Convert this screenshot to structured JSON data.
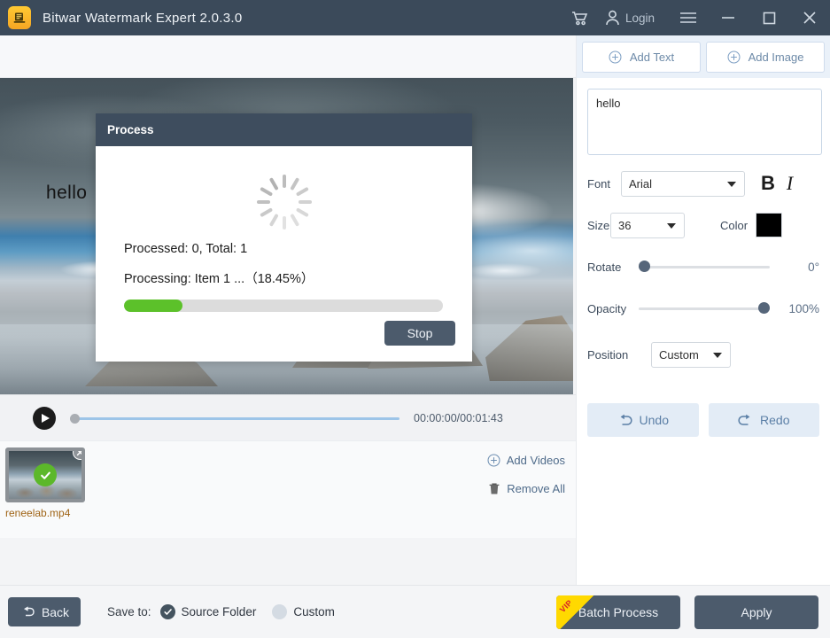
{
  "window": {
    "title": "Bitwar Watermark Expert  2.0.3.0",
    "app_icon": "app-logo-icon",
    "cart_icon": "cart-icon",
    "user_icon": "user-icon",
    "login_label": "Login",
    "menu_icon": "hamburger-menu-icon",
    "minimize_icon": "minimize-icon",
    "maximize_icon": "maximize-icon",
    "close_icon": "close-icon",
    "titlebar_color": "#3b4a5a"
  },
  "preview": {
    "watermark_text": "hello",
    "play_icon": "play-icon",
    "seek_position_percent": 0,
    "time_label": "00:00:00/00:01:43",
    "seek_color": "#9dc5e8"
  },
  "file_list": {
    "items": [
      {
        "name": "reneelab.mp4",
        "status_icon": "check-circle-icon",
        "remove_icon": "close-icon"
      }
    ],
    "add_videos_label": "Add Videos",
    "add_videos_icon": "circle-plus-icon",
    "remove_all_label": "Remove All",
    "remove_all_icon": "trash-icon"
  },
  "right_panel": {
    "add_text_label": "Add Text",
    "add_text_icon": "circle-plus-icon",
    "add_image_label": "Add Image",
    "add_image_icon": "circle-plus-icon",
    "text_value": "hello",
    "text_placeholder": "",
    "font_label": "Font",
    "font_value": "Arial",
    "bold_label": "B",
    "italic_label": "I",
    "size_label": "Size",
    "size_value": "36",
    "color_label": "Color",
    "color_value": "#000000",
    "rotate_label": "Rotate",
    "rotate_value": "0°",
    "rotate_percent": 0,
    "opacity_label": "Opacity",
    "opacity_value": "100%",
    "opacity_percent": 100,
    "position_label": "Position",
    "position_value": "Custom",
    "undo_label": "Undo",
    "undo_icon": "undo-arrow-icon",
    "redo_label": "Redo",
    "redo_icon": "redo-arrow-icon"
  },
  "bottom_bar": {
    "back_label": "Back",
    "back_icon": "back-arrow-icon",
    "save_to_label": "Save to:",
    "source_folder_label": "Source Folder",
    "source_folder_selected": true,
    "custom_label": "Custom",
    "custom_selected": false,
    "batch_process_label": "Batch Process",
    "batch_vip_badge": "VIP",
    "apply_label": "Apply"
  },
  "modal": {
    "title": "Process",
    "spinner_icon": "loading-spinner-icon",
    "processed_line": "Processed: 0, Total: 1",
    "processing_line": "Processing: Item 1 ...（18.45%）",
    "progress_percent": 18.45,
    "progress_color": "#5cc12a",
    "stop_label": "Stop"
  }
}
